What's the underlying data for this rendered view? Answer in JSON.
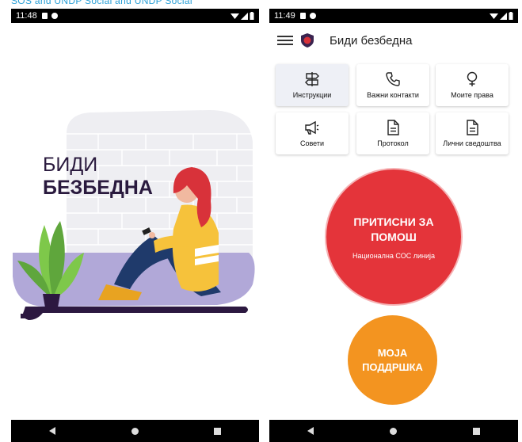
{
  "caption": "SOS and UNDP Social and UNDP Social",
  "phone1": {
    "status": {
      "time": "11:48"
    },
    "splash": {
      "title_line1": "БИДИ",
      "title_line2": "БЕЗБЕДНА"
    }
  },
  "phone2": {
    "status": {
      "time": "11:49"
    },
    "app_title": "Биди безбедна",
    "tiles": [
      {
        "label": "Инструкции",
        "icon": "signpost-icon"
      },
      {
        "label": "Важни контакти",
        "icon": "phone-icon"
      },
      {
        "label": "Моите права",
        "icon": "female-symbol-icon"
      },
      {
        "label": "Совети",
        "icon": "megaphone-icon"
      },
      {
        "label": "Протокол",
        "icon": "document-icon"
      },
      {
        "label": "Лични сведоштва",
        "icon": "document-icon"
      }
    ],
    "panic_button": {
      "line1": "ПРИТИСНИ ЗА",
      "line2": "ПОМОШ",
      "subtitle": "Национална СОС линија"
    },
    "support_button": {
      "line1": "МОЈА",
      "line2": "ПОДДРШКА"
    }
  },
  "colors": {
    "panic_red": "#e4343a",
    "support_orange": "#f39420",
    "title_purple": "#2a1a3e",
    "link_blue": "#2a9fd6"
  }
}
